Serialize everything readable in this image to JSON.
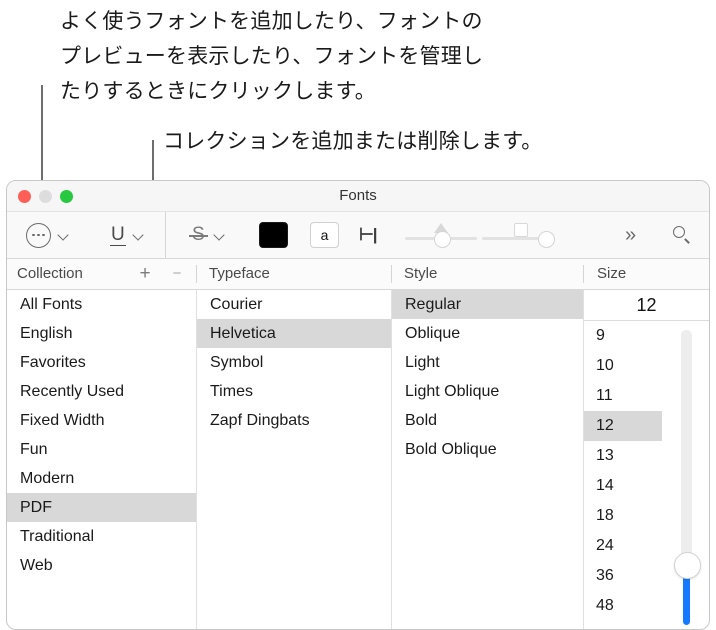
{
  "callouts": {
    "top": "よく使うフォントを追加したり、フォントの\nプレビューを表示したり、フォントを管理し\nたりするときにクリックします。",
    "second": "コレクションを追加または削除します。"
  },
  "window": {
    "title": "Fonts",
    "traffic_lights": {
      "close": "close-button",
      "minimize": "minimize-button",
      "zoom": "zoom-button"
    }
  },
  "toolbar": {
    "actions_label": "⋯",
    "underline_label": "U",
    "strikethrough_label": "S",
    "text_color": "#000000",
    "background_label": "a",
    "indent_label": "⊢|",
    "more_label": "»",
    "search_label": "search-icon",
    "shadow_opacity_slider": "shadow-opacity",
    "shadow_blur_slider": "shadow-blur"
  },
  "columns": {
    "collection": "Collection",
    "typeface": "Typeface",
    "style": "Style",
    "size": "Size",
    "add_label": "+",
    "remove_label": "−"
  },
  "collection": {
    "items": [
      "All Fonts",
      "English",
      "Favorites",
      "Recently Used",
      "Fixed Width",
      "Fun",
      "Modern",
      "PDF",
      "Traditional",
      "Web"
    ],
    "selected": "PDF"
  },
  "typeface": {
    "items": [
      "Courier",
      "Helvetica",
      "Symbol",
      "Times",
      "Zapf Dingbats"
    ],
    "selected": "Helvetica"
  },
  "style": {
    "items": [
      "Regular",
      "Oblique",
      "Light",
      "Light Oblique",
      "Bold",
      "Bold Oblique"
    ],
    "selected": "Regular"
  },
  "size": {
    "value": "12",
    "items": [
      "9",
      "10",
      "11",
      "12",
      "13",
      "14",
      "18",
      "24",
      "36",
      "48"
    ],
    "selected": "12",
    "slider_accent": "#157aff"
  }
}
